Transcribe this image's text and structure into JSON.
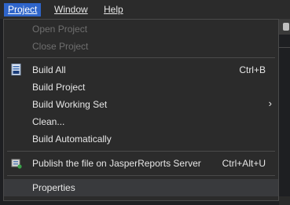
{
  "menubar": {
    "items": [
      {
        "label": "Project",
        "active": true
      },
      {
        "label": "Window"
      },
      {
        "label": "Help"
      }
    ]
  },
  "menu": {
    "items": [
      {
        "label": "Open Project",
        "enabled": false
      },
      {
        "label": "Close Project",
        "enabled": false
      },
      {
        "label": "Build All",
        "accel": "Ctrl+B",
        "icon": "build-all-icon"
      },
      {
        "label": "Build Project"
      },
      {
        "label": "Build Working Set",
        "submenu": true
      },
      {
        "label": "Clean..."
      },
      {
        "label": "Build Automatically"
      },
      {
        "label": "Publish the file on JasperReports Server",
        "accel": "Ctrl+Alt+U",
        "icon": "jasper-publish-icon"
      },
      {
        "label": "Properties",
        "highlighted": true
      }
    ]
  }
}
